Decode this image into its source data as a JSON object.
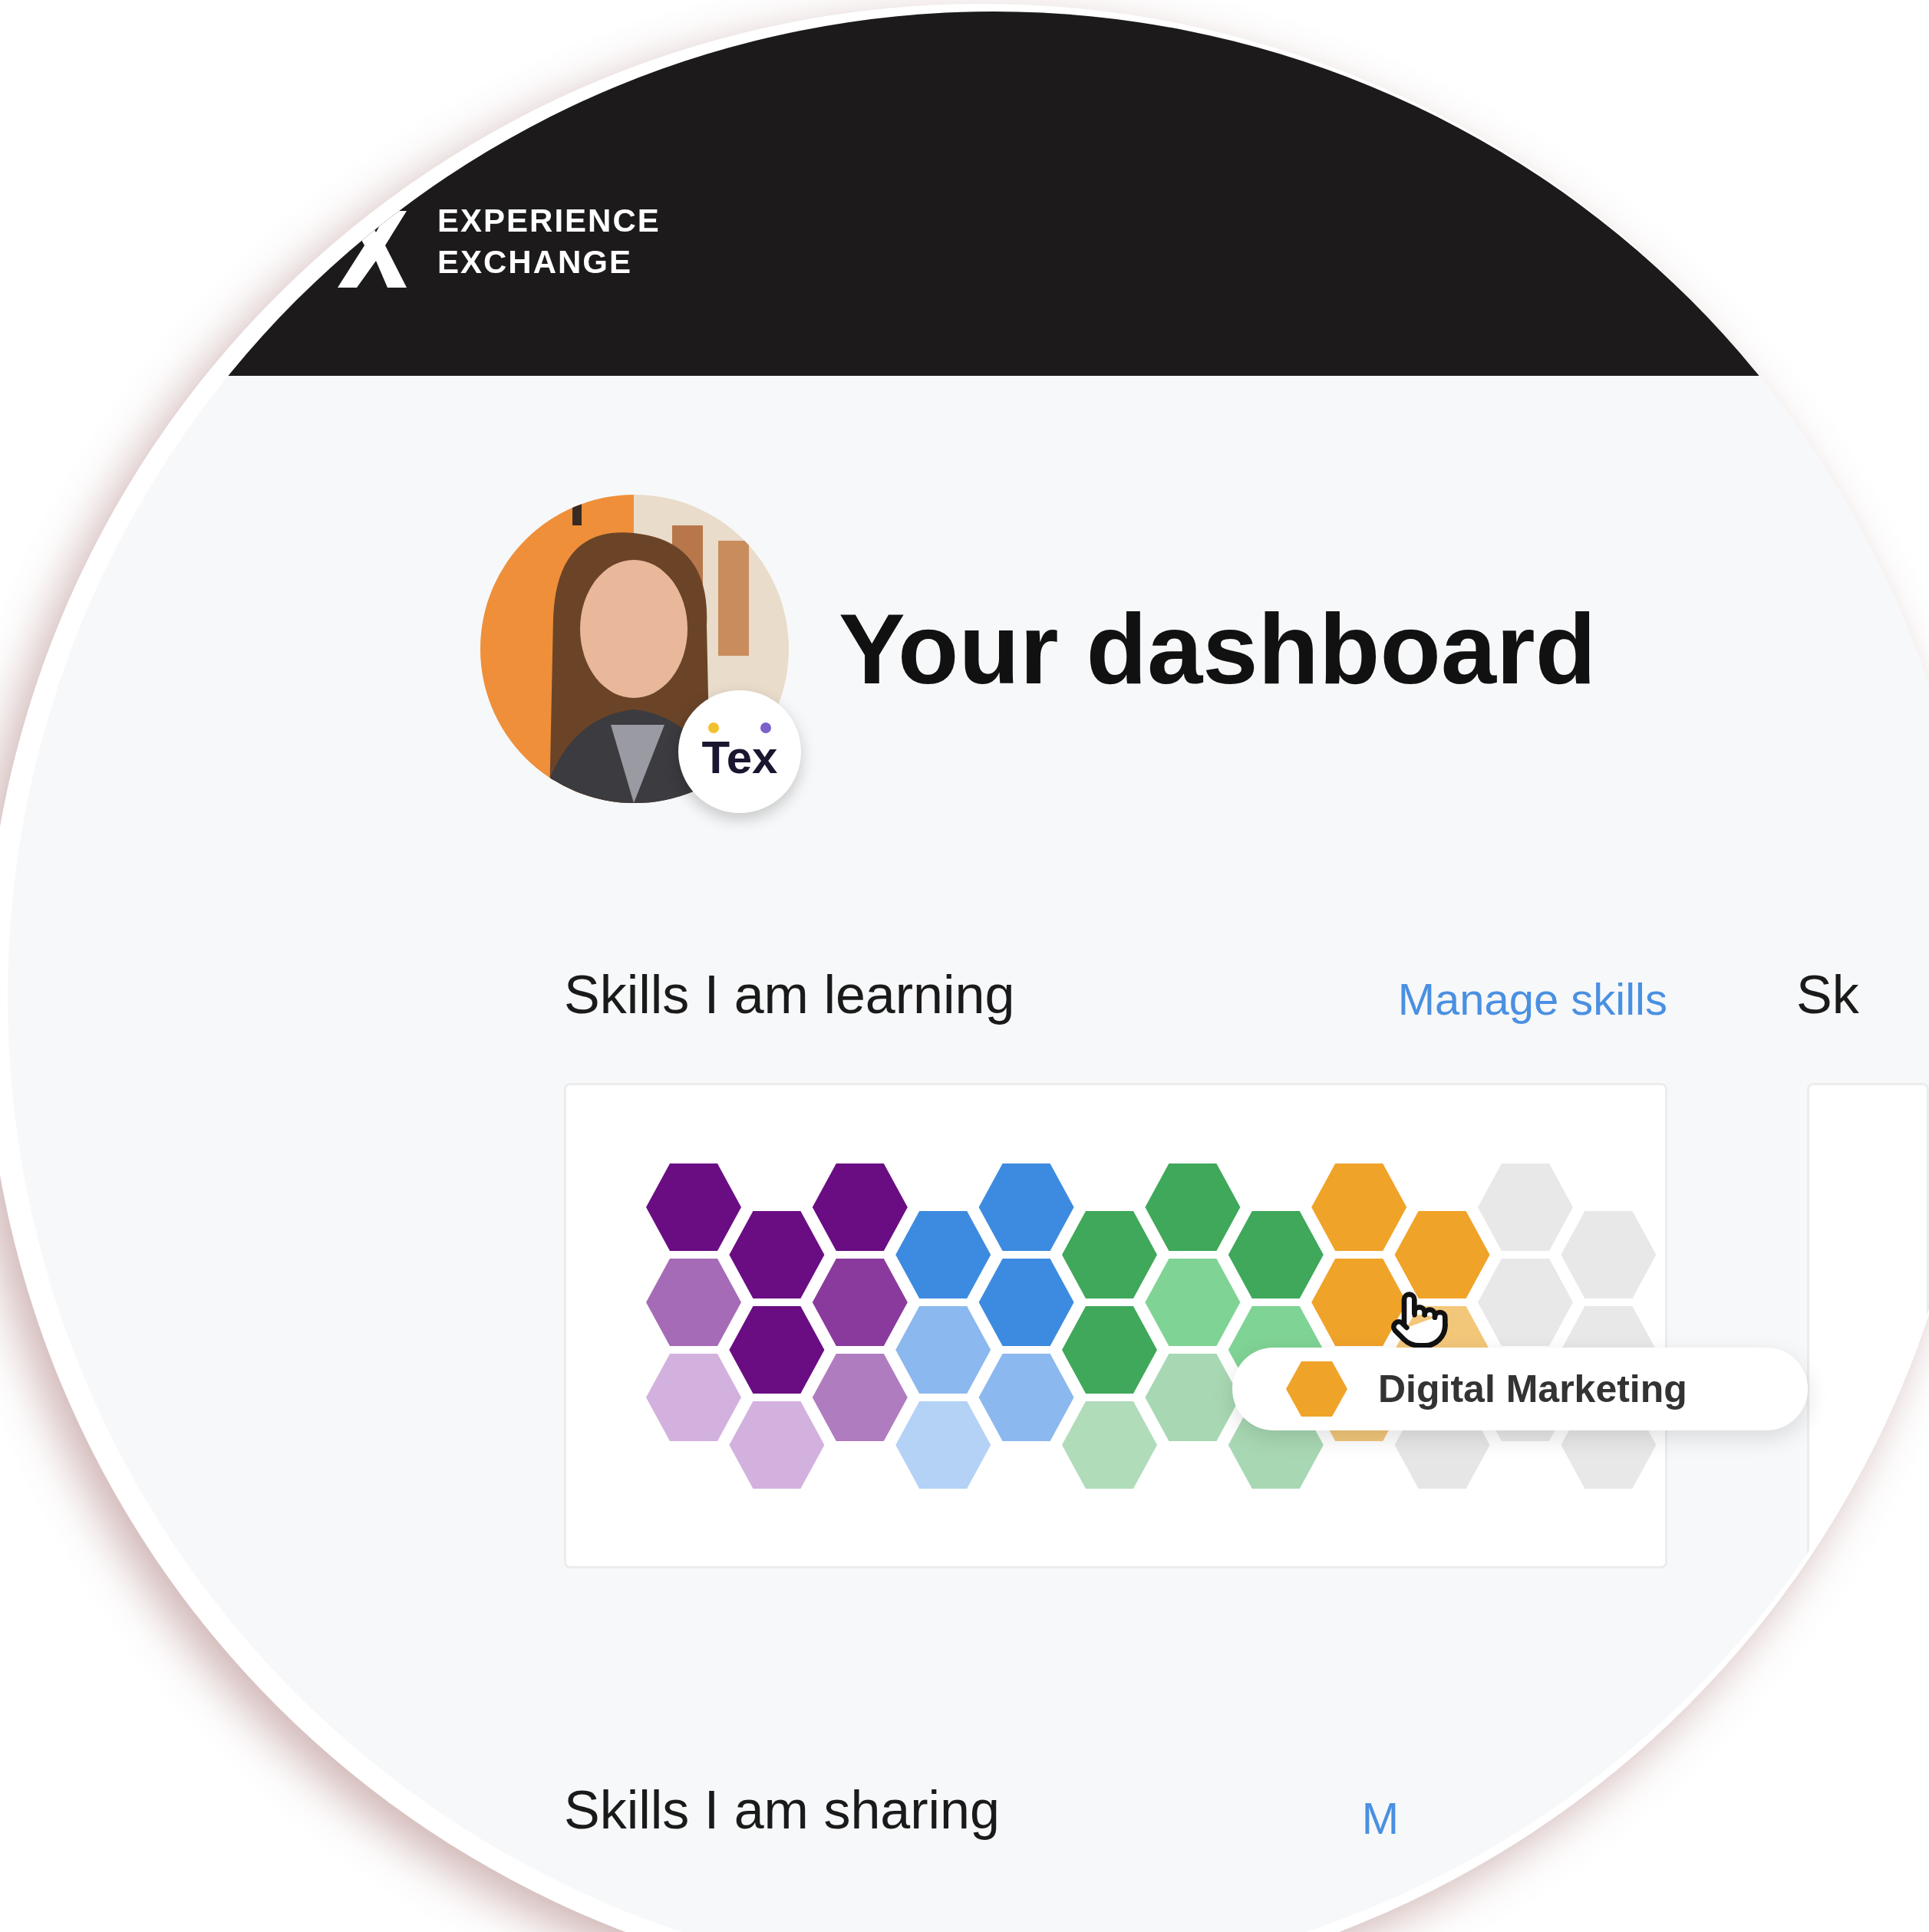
{
  "header": {
    "logo_lines": [
      "EXPERIENCE",
      "EXCHANGE"
    ]
  },
  "profile": {
    "badge": "Tex",
    "title": "Your dashboard"
  },
  "sections": [
    {
      "title": "Skills I am learning",
      "link": "Manage skills",
      "tooltip": {
        "label": "Digital Marketing",
        "color": "#f0a329"
      }
    },
    {
      "title": "Sk"
    }
  ],
  "sharing": {
    "title": "Skills I am sharing",
    "link": "M"
  }
}
